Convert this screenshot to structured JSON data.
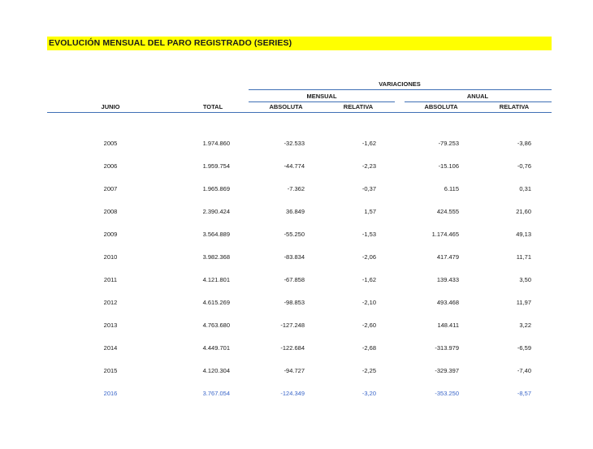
{
  "title": "EVOLUCIÓN MENSUAL DEL PARO REGISTRADO (SERIES)",
  "headers": {
    "variaciones": "VARIACIONES",
    "mensual": "MENSUAL",
    "anual": "ANUAL",
    "month": "JUNIO",
    "total": "TOTAL",
    "abs_mensual": "ABSOLUTA",
    "rel_mensual": "RELATIVA",
    "abs_anual": "ABSOLUTA",
    "rel_anual": "RELATIVA"
  },
  "colors": {
    "highlight_bar": "#ffff00",
    "rule": "#3f6fb5",
    "last_row_text": "#3a66c9"
  },
  "rows": [
    {
      "year": "2005",
      "total": "1.974.860",
      "abs_m": "-32.533",
      "rel_m": "-1,62",
      "abs_a": "-79.253",
      "rel_a": "-3,86"
    },
    {
      "year": "2006",
      "total": "1.959.754",
      "abs_m": "-44.774",
      "rel_m": "-2,23",
      "abs_a": "-15.106",
      "rel_a": "-0,76"
    },
    {
      "year": "2007",
      "total": "1.965.869",
      "abs_m": "-7.362",
      "rel_m": "-0,37",
      "abs_a": "6.115",
      "rel_a": "0,31"
    },
    {
      "year": "2008",
      "total": "2.390.424",
      "abs_m": "36.849",
      "rel_m": "1,57",
      "abs_a": "424.555",
      "rel_a": "21,60"
    },
    {
      "year": "2009",
      "total": "3.564.889",
      "abs_m": "-55.250",
      "rel_m": "-1,53",
      "abs_a": "1.174.465",
      "rel_a": "49,13"
    },
    {
      "year": "2010",
      "total": "3.982.368",
      "abs_m": "-83.834",
      "rel_m": "-2,06",
      "abs_a": "417.479",
      "rel_a": "11,71"
    },
    {
      "year": "2011",
      "total": "4.121.801",
      "abs_m": "-67.858",
      "rel_m": "-1,62",
      "abs_a": "139.433",
      "rel_a": "3,50"
    },
    {
      "year": "2012",
      "total": "4.615.269",
      "abs_m": "-98.853",
      "rel_m": "-2,10",
      "abs_a": "493.468",
      "rel_a": "11,97"
    },
    {
      "year": "2013",
      "total": "4.763.680",
      "abs_m": "-127.248",
      "rel_m": "-2,60",
      "abs_a": "148.411",
      "rel_a": "3,22"
    },
    {
      "year": "2014",
      "total": "4.449.701",
      "abs_m": "-122.684",
      "rel_m": "-2,68",
      "abs_a": "-313.979",
      "rel_a": "-6,59"
    },
    {
      "year": "2015",
      "total": "4.120.304",
      "abs_m": "-94.727",
      "rel_m": "-2,25",
      "abs_a": "-329.397",
      "rel_a": "-7,40"
    },
    {
      "year": "2016",
      "total": "3.767.054",
      "abs_m": "-124.349",
      "rel_m": "-3,20",
      "abs_a": "-353.250",
      "rel_a": "-8,57"
    }
  ]
}
